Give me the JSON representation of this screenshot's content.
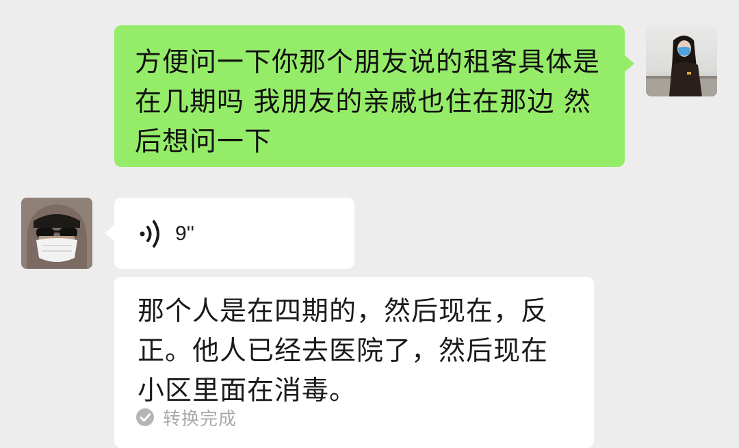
{
  "conversation": {
    "messages": [
      {
        "sender": "me",
        "type": "text",
        "text": "方便问一下你那个朋友说的租客具体是在几期吗 我朋友的亲戚也住在那边 然后想问一下"
      },
      {
        "sender": "other",
        "type": "voice",
        "duration": "9''",
        "transcript": "那个人是在四期的，然后现在，反正。他人已经去医院了，然后现在小区里面在消毒。",
        "transcript_status": "转换完成"
      }
    ]
  },
  "colors": {
    "background": "#ededed",
    "sent_bubble": "#95ec69",
    "received_bubble": "#ffffff",
    "status_text": "#a9a9a9"
  },
  "icons": {
    "voice": "voice-wave-icon",
    "status": "check-circle-icon"
  }
}
